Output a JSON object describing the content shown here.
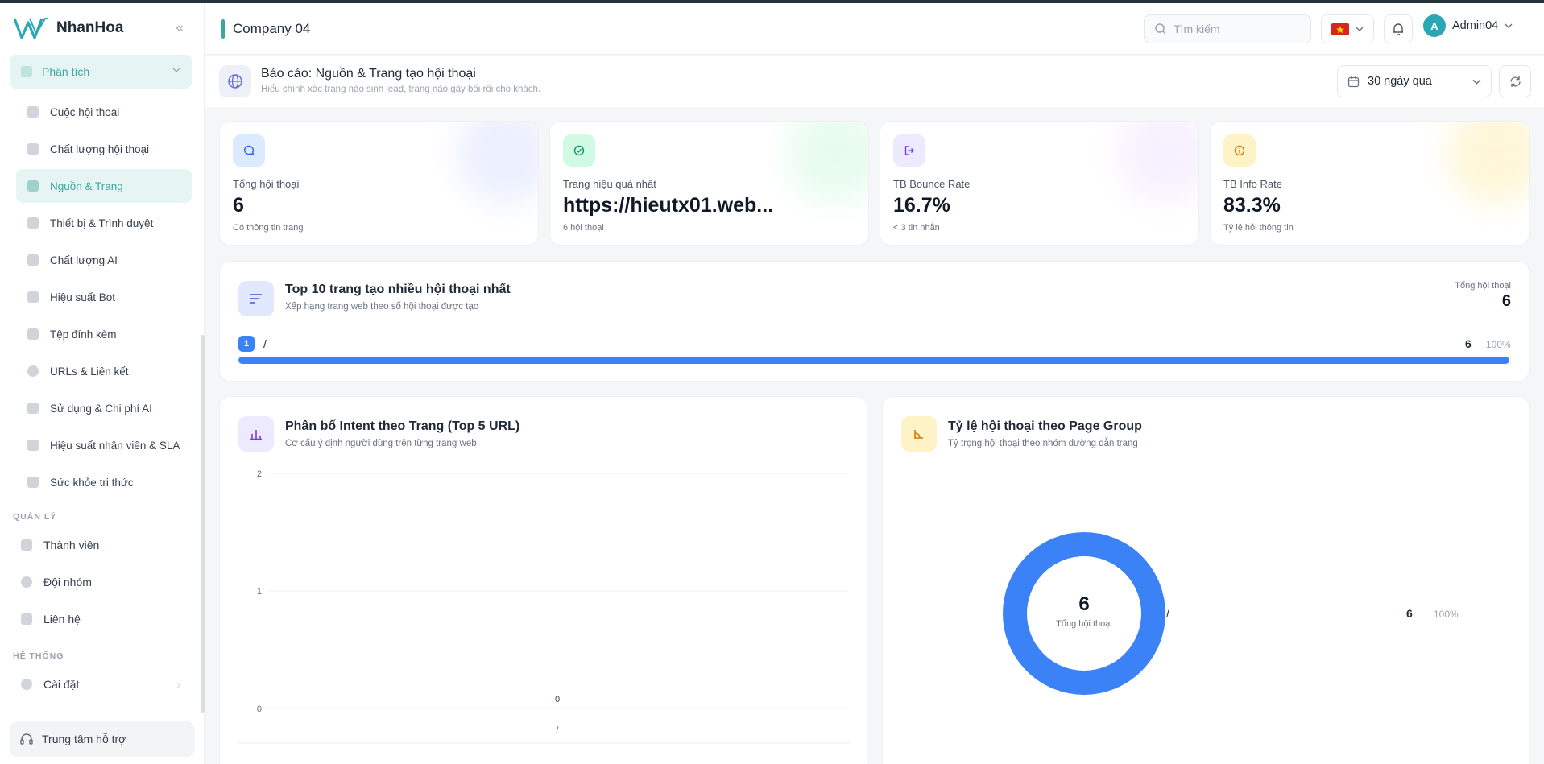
{
  "brand": {
    "name": "NhanHoa"
  },
  "sidebar": {
    "group": {
      "label": "Phân tích"
    },
    "subitems": [
      {
        "label": "Cuộc hội thoại"
      },
      {
        "label": "Chất lượng hội thoại"
      },
      {
        "label": "Nguồn & Trang"
      },
      {
        "label": "Thiết bị & Trình duyệt"
      },
      {
        "label": "Chất lượng AI"
      },
      {
        "label": "Hiệu suất Bot"
      },
      {
        "label": "Tệp đính kèm"
      },
      {
        "label": "URLs & Liên kết"
      },
      {
        "label": "Sử dụng & Chi phí AI"
      },
      {
        "label": "Hiệu suất nhân viên & SLA"
      },
      {
        "label": "Sức khỏe tri thức"
      }
    ],
    "section_manage": "QUẢN LÝ",
    "manage_items": [
      {
        "label": "Thành viên"
      },
      {
        "label": "Đội nhóm"
      },
      {
        "label": "Liên hệ"
      }
    ],
    "section_system": "HỆ THỐNG",
    "system_items": [
      {
        "label": "Cài đặt"
      }
    ],
    "support": "Trung tâm hỗ trợ"
  },
  "header": {
    "company": "Company 04",
    "search_placeholder": "Tìm kiếm",
    "user": "Admin04",
    "avatar_initial": "A"
  },
  "page": {
    "title": "Báo cáo: Nguồn & Trang tạo hội thoại",
    "subtitle": "Hiểu chính xác trang nào sinh lead, trang nào gây bối rối cho khách.",
    "range": "30 ngày qua"
  },
  "kpis": [
    {
      "label": "Tổng hội thoại",
      "value": "6",
      "note": "Có thông tin trang"
    },
    {
      "label": "Trang hiệu quả nhất",
      "value": "https://hieutx01.web...",
      "note": "6 hội thoại"
    },
    {
      "label": "TB Bounce Rate",
      "value": "16.7%",
      "note": "< 3 tin nhắn"
    },
    {
      "label": "TB Info Rate",
      "value": "83.3%",
      "note": "Tỷ lệ hỏi thông tin"
    }
  ],
  "top_pages": {
    "title": "Top 10 trang tạo nhiều hội thoại nhất",
    "subtitle": "Xếp hạng trang web theo số hội thoại được tạo",
    "total_label": "Tổng hội thoại",
    "total_value": "6",
    "rows": [
      {
        "rank": "1",
        "path": "/",
        "count": "6",
        "pct_label": "100%",
        "share": 1.0
      }
    ]
  },
  "intent_chart": {
    "title": "Phân bố Intent theo Trang (Top 5 URL)",
    "subtitle": "Cơ cấu ý định người dùng trên từng trang web"
  },
  "group_chart": {
    "title": "Tỷ lệ hội thoại theo Page Group",
    "subtitle": "Tỷ trọng hội thoại theo nhóm đường dẫn trang",
    "center_value": "6",
    "center_label": "Tổng hội thoại",
    "legend": [
      {
        "name": "/",
        "value": "6",
        "pct": "100%"
      }
    ]
  },
  "chart_data": [
    {
      "type": "bar",
      "categories": [
        "/"
      ],
      "values": [
        0
      ],
      "data_labels": [
        "0"
      ],
      "ylim": [
        0,
        2
      ],
      "yticks": [
        "0",
        "1",
        "2"
      ],
      "grid": true
    },
    {
      "type": "pie",
      "categories": [
        "/"
      ],
      "values": [
        6
      ],
      "percent": [
        100
      ],
      "colors": [
        "#3b82f6"
      ]
    }
  ],
  "colors": {
    "accent": "#3aa8a0",
    "primary_blue": "#3b82f6"
  }
}
